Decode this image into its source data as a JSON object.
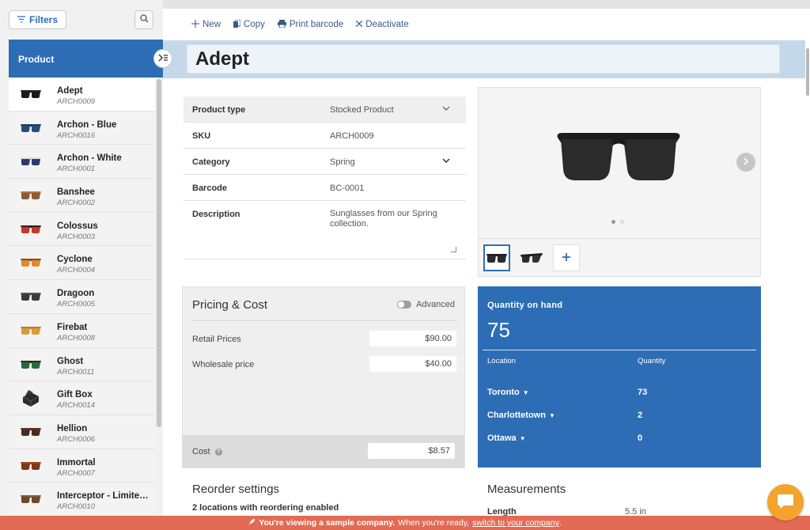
{
  "sidebar": {
    "filters_label": "Filters",
    "list_header": "Product",
    "items": [
      {
        "name": "Adept",
        "code": "ARCH0009",
        "lens": "#1a1a1a",
        "frame": "#222"
      },
      {
        "name": "Archon - Blue",
        "code": "ARCH0016",
        "lens": "#2b4a7a",
        "frame": "#1d3a66"
      },
      {
        "name": "Archon - White",
        "code": "ARCH0001",
        "lens": "#2b3a6a",
        "frame": "#ddd"
      },
      {
        "name": "Banshee",
        "code": "ARCH0002",
        "lens": "#8a5a3a",
        "frame": "#b5723d"
      },
      {
        "name": "Colossus",
        "code": "ARCH0003",
        "lens": "#c23a2a",
        "frame": "#3a1a1a"
      },
      {
        "name": "Cyclone",
        "code": "ARCH0004",
        "lens": "#e08a2a",
        "frame": "#8a4a1a"
      },
      {
        "name": "Dragoon",
        "code": "ARCH0005",
        "lens": "#3a3a3a",
        "frame": "#555"
      },
      {
        "name": "Firebat",
        "code": "ARCH0008",
        "lens": "#d89a3a",
        "frame": "#c07a2a"
      },
      {
        "name": "Ghost",
        "code": "ARCH0011",
        "lens": "#2a6a3a",
        "frame": "#1a3a1a"
      },
      {
        "name": "Gift Box",
        "code": "ARCH0014",
        "lens": "",
        "frame": ""
      },
      {
        "name": "Hellion",
        "code": "ARCH0006",
        "lens": "#4a2a1a",
        "frame": "#5a3a2a"
      },
      {
        "name": "Immortal",
        "code": "ARCH0007",
        "lens": "#7a3a1a",
        "frame": "#a04a2a"
      },
      {
        "name": "Interceptor - Limited...",
        "code": "ARCH0010",
        "lens": "#6a4a2a",
        "frame": "#8a5a3a"
      }
    ]
  },
  "toolbar": {
    "new_label": "New",
    "copy_label": "Copy",
    "print_label": "Print barcode",
    "deactivate_label": "Deactivate"
  },
  "product": {
    "title": "Adept",
    "fields": {
      "type_label": "Product type",
      "type_value": "Stocked Product",
      "sku_label": "SKU",
      "sku_value": "ARCH0009",
      "category_label": "Category",
      "category_value": "Spring",
      "barcode_label": "Barcode",
      "barcode_value": "BC-0001",
      "description_label": "Description",
      "description_value": "Sunglasses from our Spring collection."
    }
  },
  "pricing": {
    "title": "Pricing & Cost",
    "advanced_label": "Advanced",
    "retail_label": "Retail Prices",
    "retail_value": "$90.00",
    "wholesale_label": "Wholesale price",
    "wholesale_value": "$40.00",
    "cost_label": "Cost",
    "cost_value": "$8.57"
  },
  "quantity": {
    "label": "Quantity on hand",
    "value": "75",
    "col_location": "Location",
    "col_quantity": "Quantity",
    "rows": [
      {
        "location": "Toronto",
        "qty": "73"
      },
      {
        "location": "Charlottetown",
        "qty": "2"
      },
      {
        "location": "Ottawa",
        "qty": "0"
      }
    ]
  },
  "reorder": {
    "title": "Reorder settings",
    "subtitle": "2 locations with reordering enabled"
  },
  "measurements": {
    "title": "Measurements",
    "length_label": "Length",
    "length_value": "5.5 in"
  },
  "banner": {
    "prefix": "You're viewing a sample company.",
    "middle": "When you're ready,",
    "link": "switch to your company",
    "suffix": "."
  },
  "colors": {
    "brand_blue": "#2d6db5",
    "banner_red": "#e36b55",
    "chat_orange": "#f2a42d"
  }
}
